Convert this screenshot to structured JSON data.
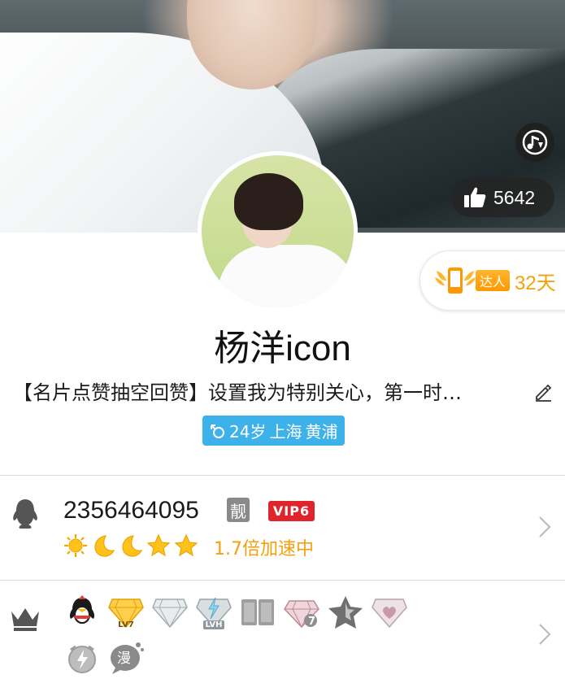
{
  "cover": {
    "music_icon": "music-note-icon",
    "likes": "5642"
  },
  "daren": {
    "label": "达人",
    "days": "32天"
  },
  "profile": {
    "nickname": "杨洋icon",
    "signature": "【名片点赞抽空回赞】设置我为特别关心，第一时…",
    "gender_icon": "male-icon",
    "age": "24岁",
    "city": "上海",
    "district": "黄浦"
  },
  "account": {
    "qq_number": "2356464095",
    "liang_badge": "靓",
    "vip_badge": "VIP6",
    "level_icons": [
      "sun-icon",
      "moon-icon",
      "moon-icon",
      "star-icon",
      "star-icon"
    ],
    "speed_text": "1.7倍加速中"
  },
  "badges": {
    "items": [
      {
        "name": "qq-penguin-badge",
        "label": ""
      },
      {
        "name": "gold-diamond-badge",
        "label": "LV7"
      },
      {
        "name": "silver-diamond-badge",
        "label": ""
      },
      {
        "name": "lightning-diamond-badge",
        "label": "LVH"
      },
      {
        "name": "book-badge",
        "label": ""
      },
      {
        "name": "ruby-badge",
        "label": "7"
      },
      {
        "name": "star-badge",
        "label": ""
      },
      {
        "name": "heart-diamond-badge",
        "label": ""
      },
      {
        "name": "speed-badge",
        "label": ""
      },
      {
        "name": "comic-badge",
        "label": "漫"
      }
    ]
  },
  "colors": {
    "accent_blue": "#3cb1ea",
    "orange": "#f4a10d",
    "vip_red": "#e0242b"
  }
}
